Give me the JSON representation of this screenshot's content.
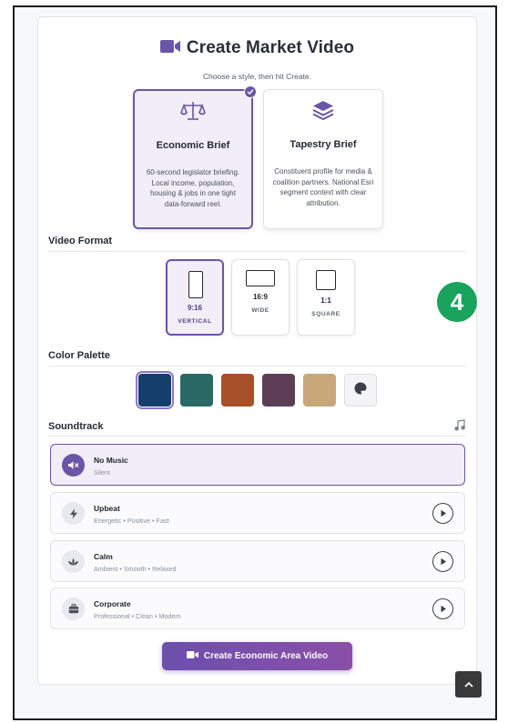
{
  "header": {
    "title": "Create Market Video",
    "subtitle": "Choose a style, then hit Create."
  },
  "styles": [
    {
      "name": "Economic Brief",
      "description": "60-second legislator briefing. Local income, population, housing & jobs in one tight data-forward reel.",
      "icon": "scales-icon",
      "selected": true
    },
    {
      "name": "Tapestry Brief",
      "description": "Constituent profile for media & coalition partners. National Esri segment context with clear attribution.",
      "icon": "layers-icon",
      "selected": false
    }
  ],
  "video_format": {
    "label": "Video Format",
    "options": [
      {
        "ratio": "9:16",
        "name": "VERTICAL",
        "selected": true
      },
      {
        "ratio": "16:9",
        "name": "WIDE",
        "selected": false
      },
      {
        "ratio": "1:1",
        "name": "SQUARE",
        "selected": false
      }
    ]
  },
  "color_palette": {
    "label": "Color Palette",
    "swatches": [
      "#163e6d",
      "#2a6a66",
      "#a6512a",
      "#5c3e57",
      "#c9a77a"
    ],
    "selected_index": 0,
    "custom_icon": "palette-icon"
  },
  "soundtrack": {
    "label": "Soundtrack",
    "icon": "music-note-icon",
    "tracks": [
      {
        "name": "No Music",
        "description": "Silent",
        "icon": "mute-icon",
        "selected": true
      },
      {
        "name": "Upbeat",
        "description": "Energetic • Positive • Fast",
        "icon": "bolt-icon",
        "selected": false
      },
      {
        "name": "Calm",
        "description": "Ambient • Smooth • Relaxed",
        "icon": "lotus-icon",
        "selected": false
      },
      {
        "name": "Corporate",
        "description": "Professional • Clean • Modern",
        "icon": "briefcase-icon",
        "selected": false
      }
    ]
  },
  "cta": {
    "label": "Create Economic Area Video"
  },
  "badge": {
    "label": "4"
  },
  "colors": {
    "accent": "#6a55a6",
    "badge": "#1aa35c"
  }
}
